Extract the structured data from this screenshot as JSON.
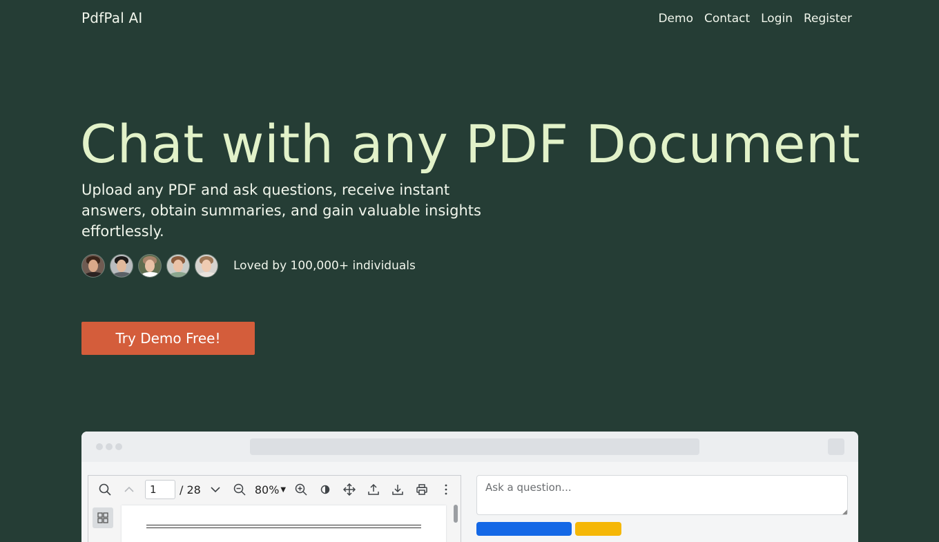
{
  "nav": {
    "logo": "PdfPal AI",
    "links": [
      "Demo",
      "Contact",
      "Login",
      "Register"
    ]
  },
  "hero": {
    "title": "Chat with any PDF Document",
    "subtitle": "Upload any PDF and ask questions, receive instant answers, obtain summaries, and gain valuable insights effortlessly.",
    "social_proof": "Loved by 100,000+ individuals",
    "cta_label": "Try Demo Free!"
  },
  "viewer": {
    "page_value": "1",
    "page_total": "/ 28",
    "zoom": "80%"
  },
  "chat": {
    "placeholder": "Ask a question..."
  },
  "colors": {
    "background": "#253d35",
    "title": "#e2f2c9",
    "cta": "#d45d3b",
    "ask_button": "#1468e6",
    "clear_button": "#f5b707"
  }
}
